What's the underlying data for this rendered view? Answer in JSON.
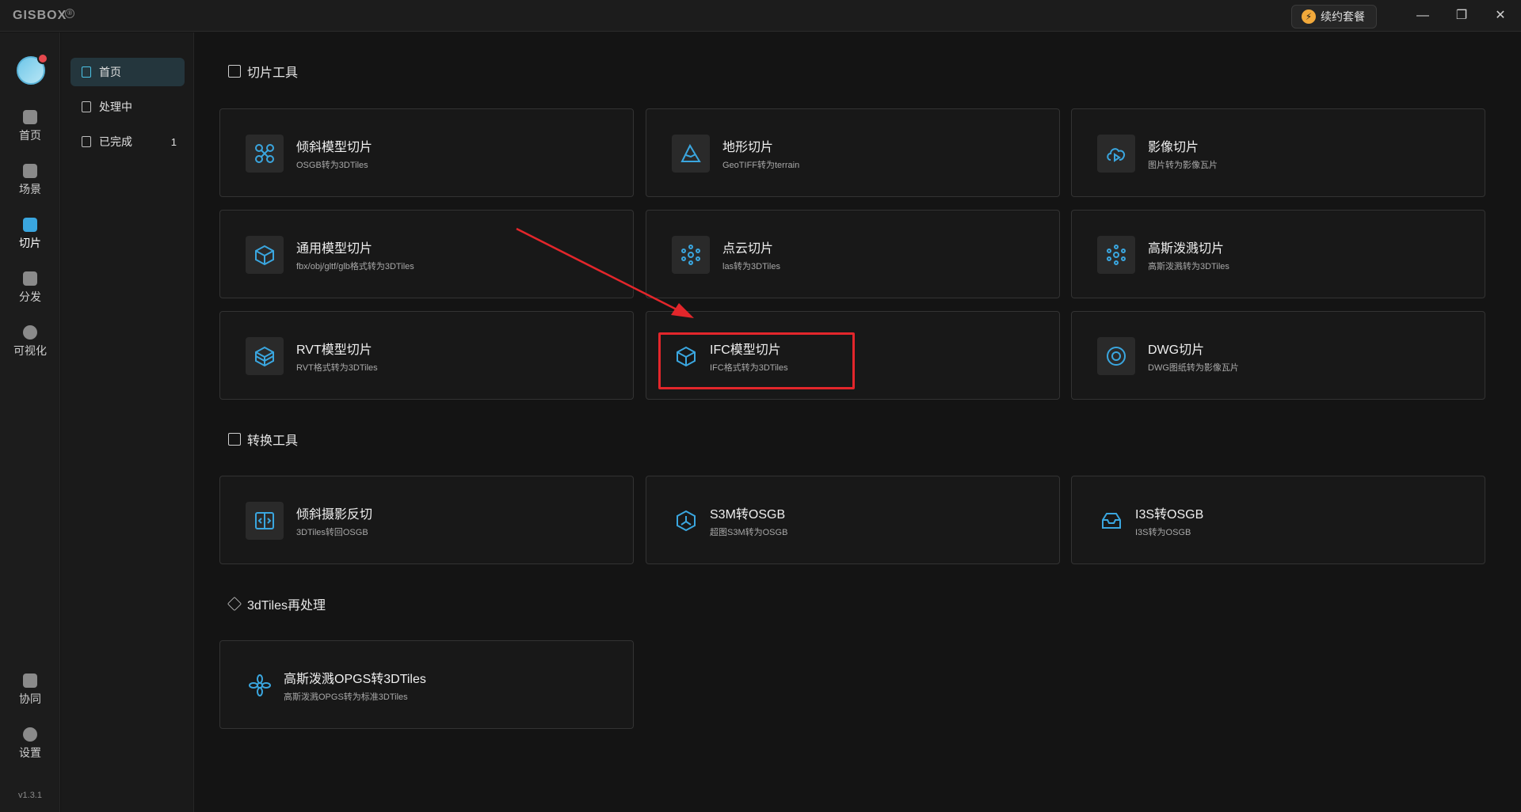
{
  "app": {
    "logo": "GISBOX",
    "badge": "®"
  },
  "titlebar": {
    "renew_label": "续约套餐",
    "minimize": "—",
    "restore": "❐",
    "close": "✕"
  },
  "leftnav": {
    "items": [
      {
        "label": "首页",
        "icon": "home-icon"
      },
      {
        "label": "场景",
        "icon": "cube-icon"
      },
      {
        "label": "切片",
        "icon": "slice-icon",
        "active": true
      },
      {
        "label": "分发",
        "icon": "distribute-icon"
      },
      {
        "label": "可视化",
        "icon": "visual-icon"
      },
      {
        "label": "协同",
        "icon": "lock-icon"
      },
      {
        "label": "设置",
        "icon": "gear-icon"
      }
    ],
    "version": "v1.3.1"
  },
  "subnav": {
    "items": [
      {
        "label": "首页",
        "active": true
      },
      {
        "label": "处理中"
      },
      {
        "label": "已完成",
        "count": "1"
      }
    ]
  },
  "sections": {
    "slice": "切片工具",
    "convert": "转换工具",
    "reprocess": "3dTiles再处理"
  },
  "cards": [
    {
      "title": "倾斜模型切片",
      "sub": "OSGB转为3DTiles"
    },
    {
      "title": "地形切片",
      "sub": "GeoTIFF转为terrain"
    },
    {
      "title": "影像切片",
      "sub": "图片转为影像瓦片"
    },
    {
      "title": "通用模型切片",
      "sub": "fbx/obj/gltf/glb格式转为3DTiles"
    },
    {
      "title": "点云切片",
      "sub": "las转为3DTiles"
    },
    {
      "title": "高斯泼溅切片",
      "sub": "高斯泼溅转为3DTiles"
    },
    {
      "title": "RVT模型切片",
      "sub": "RVT格式转为3DTiles"
    },
    {
      "title": "IFC模型切片",
      "sub": "IFC格式转为3DTiles"
    },
    {
      "title": "DWG切片",
      "sub": "DWG图纸转为影像瓦片"
    },
    {
      "title": "倾斜摄影反切",
      "sub": "3DTiles转回OSGB"
    },
    {
      "title": "S3M转OSGB",
      "sub": "超图S3M转为OSGB"
    },
    {
      "title": "I3S转OSGB",
      "sub": "I3S转为OSGB"
    },
    {
      "title": "高斯泼溅OPGS转3DTiles",
      "sub": "高斯泼溅OPGS转为标准3DTiles"
    }
  ],
  "colors": {
    "accent": "#3aa6df",
    "highlight": "#e3262b"
  }
}
